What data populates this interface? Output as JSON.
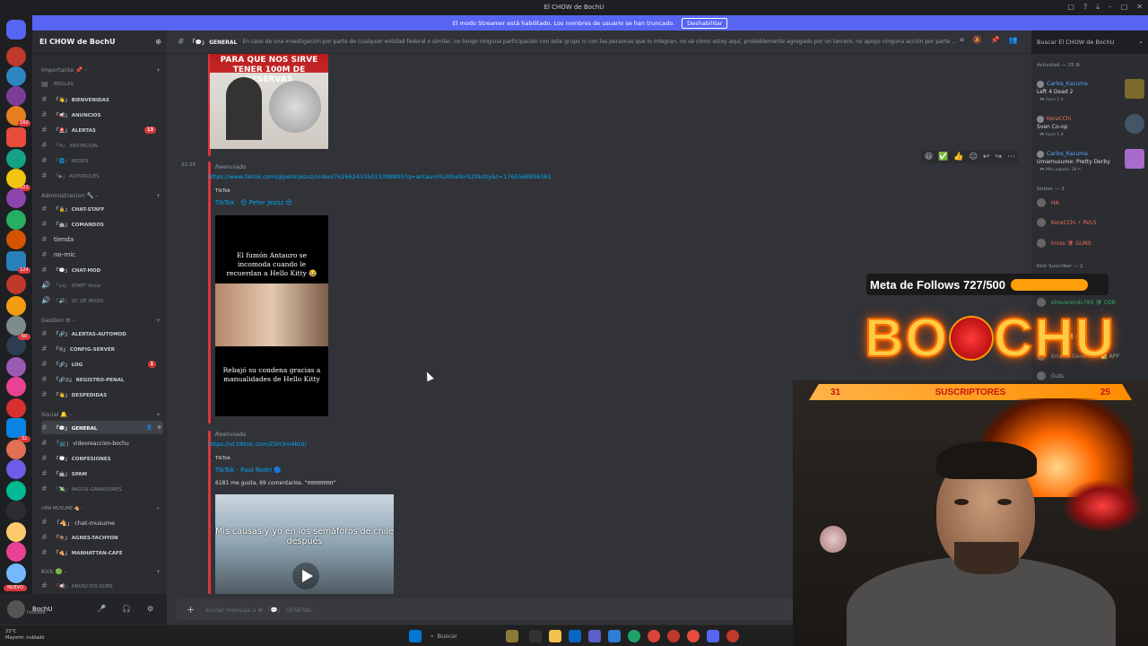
{
  "window": {
    "title": "El CHOW de BochU"
  },
  "banner": {
    "text": "El modo Streamer está habilitado. Los nombres de usuario se han truncado.",
    "button": "Deshabilitar"
  },
  "guilds": {
    "badges": [
      "160",
      "122",
      "124",
      "60",
      "32",
      "NUEVO"
    ]
  },
  "server": {
    "name": "El CHOW de BochU"
  },
  "categories": [
    {
      "label": "Importante 📌 -"
    },
    {
      "label": "Administracion 🔧 -"
    },
    {
      "label": "Gestion ⚙ -"
    },
    {
      "label": "Social 🔔 -"
    },
    {
      "label": "UMA MUSUME 🐴 -"
    },
    {
      "label": "Kick 🟢 -"
    }
  ],
  "channels": [
    {
      "label": "REGLAS"
    },
    {
      "label": "「👋」 BIENVENIDAS"
    },
    {
      "label": "「📢」 ANUNCIOS"
    },
    {
      "label": "「🚨」 ALERTAS",
      "badge": "13"
    },
    {
      "label": "「✉」 INVITACION"
    },
    {
      "label": "「🌐」 REDES"
    },
    {
      "label": "「▶」 AUTOROLES"
    },
    {
      "label": "「🔒」 CHAT-STAFF"
    },
    {
      "label": "「🤖」 COMANDOS"
    },
    {
      "label": "tienda"
    },
    {
      "label": "no-mic"
    },
    {
      "label": "「💬」 CHAT-MOD"
    },
    {
      "label": "「xd」 STAFF Voice"
    },
    {
      "label": "「🔊」 VC DE MODS"
    },
    {
      "label": "「🔗」 ALERTAS-AUTOMOD"
    },
    {
      "label": "「⚙」 CONFIG-SERVER"
    },
    {
      "label": "「🔗」 LOG",
      "badge": "1"
    },
    {
      "label": "「🔗⚖」 REGISTRO-PENAL"
    },
    {
      "label": "「👋」 DESPEDIDAS"
    },
    {
      "label": "「💬」 GENERAL"
    },
    {
      "label": "「📺」 videoreaccion-bochu"
    },
    {
      "label": "「💭」 CONFESIONES"
    },
    {
      "label": "「🤖」 SPAM"
    },
    {
      "label": "「💸」 PAGOS-GANADORES"
    },
    {
      "label": "「🐴」 chat-musume"
    },
    {
      "label": "「🏇」 AGNES-TACHYON"
    },
    {
      "label": "「🐴」 MANHATTAN-CAFE"
    },
    {
      "label": "「📢」 ANUNCIOS-SUBS"
    }
  ],
  "user": {
    "name": "BochU",
    "status": "Invisible",
    "weather_temp": "23°C",
    "weather_desc": "Mayorm. nublado"
  },
  "header": {
    "channel": "「💬」 GENERAL",
    "topic": "En caso de una investigación por parte de cualquier entidad federal o similar, no tengo ninguna participación con este grupo ni con las personas que lo integran, no sé cómo estoy aquí, probablemente agregado por un tercero, no apoyo ninguna acción por parte de...",
    "search_placeholder": "Buscar El CHOW de BochU"
  },
  "messages": [
    {
      "image_text": "PARA QUE NOS SIRVE TENER 100M DE RESERVAS"
    },
    {
      "time": "22:33",
      "forwarded": "Reenviado",
      "link": "https://www.tiktok.com/@peterjezuz/video/7616624105013398805?q=antauro%20hello%20kitty&t=1765568856361",
      "provider": "TikTok",
      "author": "TikTok · 😍 Peter Jezúz 😍",
      "image_title": "El fumón Antauro se incomoda cuando le recuerdan a Hello Kitty 😂",
      "image_caption": "Rebajó su condena gracias a manualidades de Hello Kitty"
    },
    {
      "forwarded": "Reenviado",
      "link": "https://vt.tiktok.com/ZSH3m4bUt/",
      "provider": "TikTok",
      "author": "TikTok · Paul Rodri 🔵",
      "description": "6181 me gusta, 69 comentarios. \"ππππππππ\"",
      "image_title": "Mis causas y yo en los semáforos de chile después"
    }
  ],
  "input": {
    "placeholder": "Enviar mensaje a # 「💬」 GENERAL"
  },
  "members": {
    "activity_header": "Actividad — 15 ⚙",
    "activities": [
      {
        "name": "Carlos_Kazuma",
        "game": "Left 4 Dead 2",
        "time": "🎮 hace 2 d"
      },
      {
        "name": "KoraCChi",
        "game": "Sven Co-op",
        "time": "🎮 hace 1 d"
      },
      {
        "name": "Carlos_Kazuma",
        "game": "Umamusume: Pretty Derby",
        "time": "🎮 Más jugado: 29 h"
      }
    ],
    "striker_header": "Striker — 3",
    "strikers": [
      {
        "name": "HA"
      },
      {
        "name": "KoraCChi ⚡ RVLS"
      },
      {
        "name": "kross 🛡 GUNS"
      }
    ],
    "kick_header": "Kick Suscriber — 2",
    "kick_members": [
      {
        "name": "elreverendo789 🛡 COB"
      },
      {
        "name": "Dyno ✅ APP"
      },
      {
        "name": "Embed Generator ✅ APP"
      },
      {
        "name": "Guts"
      }
    ]
  },
  "overlay": {
    "goal_label": "Meta de Follows 727/500",
    "goal_progress": 1.0,
    "logo": "BOCHU",
    "subs_left": "31",
    "subs_label": "SUSCRIPTORES",
    "subs_right": "25"
  },
  "taskbar": {
    "search": "Buscar"
  },
  "colors": {
    "accent": "#5865f2",
    "danger": "#da373c",
    "link": "#00a8fc",
    "goal": "#ff9f0a"
  }
}
